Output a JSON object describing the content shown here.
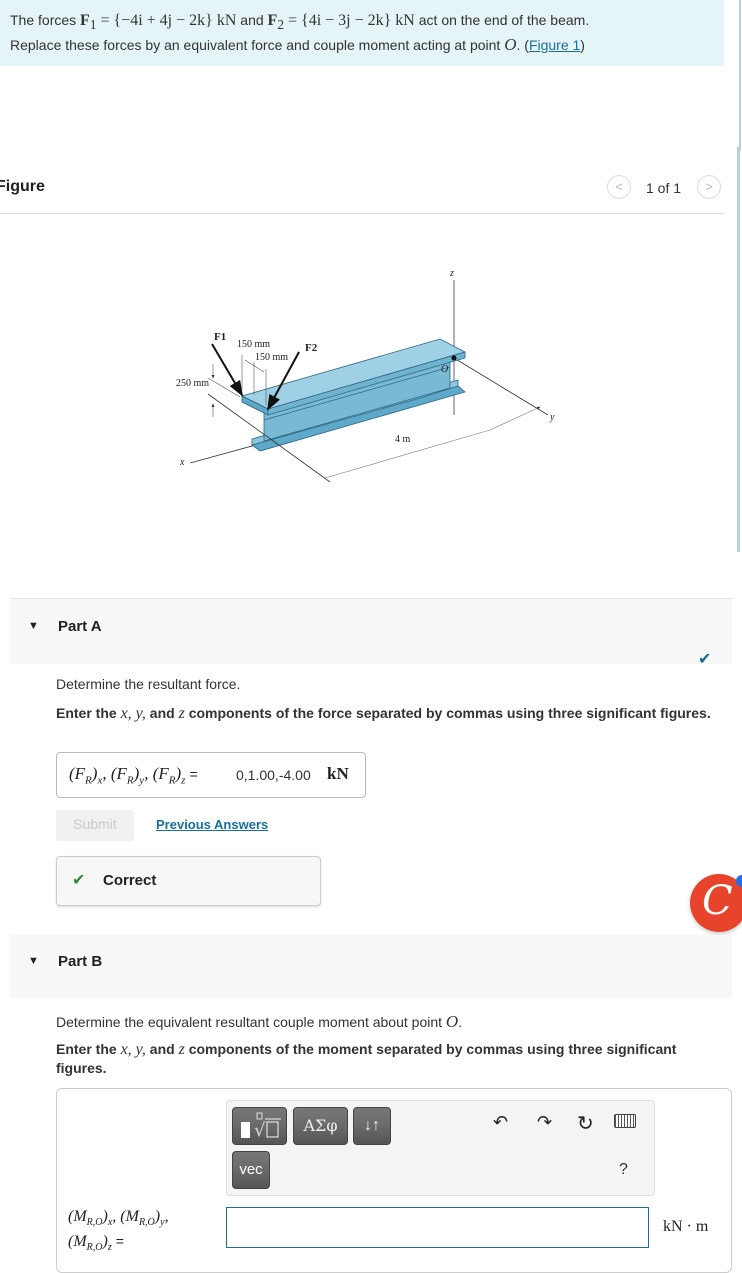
{
  "problem": {
    "intro": "The forces",
    "f1_label": "F",
    "f1_sub": "1",
    "f1_value": "= {−4i + 4j − 2k} kN",
    "and": "and",
    "f2_label": "F",
    "f2_sub": "2",
    "f2_value": "= {4i − 3j − 2k} kN",
    "suffix": "act on the end of the beam.",
    "line2": "Replace these forces by an equivalent force and couple moment acting at point",
    "point": "O",
    "link_open": ". (",
    "link_text": "Figure 1",
    "link_close": ")"
  },
  "figure": {
    "title": "Figure",
    "pager": "1 of 1",
    "prev_icon": "chevron-left-icon",
    "next_icon": "chevron-right-icon",
    "labels": {
      "f1": "F1",
      "f2": "F2",
      "dim_150_a": "150 mm",
      "dim_150_b": "150 mm",
      "dim_250": "250 mm",
      "dim_4m": "4 m",
      "axis_x": "x",
      "axis_y": "y",
      "axis_z": "z",
      "origin": "O"
    }
  },
  "partA": {
    "title": "Part A",
    "toggle_icon": "▼",
    "status_icon": "✔",
    "prompt": "Determine the resultant force.",
    "instruction_pre": "Enter the",
    "instruction_vars": "x, y,",
    "instruction_and": "and",
    "instruction_z": "z",
    "instruction_post": "components of the force separated by commas using three significant figures.",
    "answer_label": "(F_R)_x, (F_R)_y, (F_R)_z =",
    "answer_value": "0,1.00,-4.00",
    "answer_unit": "kN",
    "submit_label": "Submit",
    "previous_answers_label": "Previous Answers",
    "feedback_icon": "✔",
    "feedback_text": "Correct"
  },
  "partB": {
    "title": "Part B",
    "toggle_icon": "▼",
    "prompt_pre": "Determine the equivalent resultant couple moment about point",
    "prompt_point": "O",
    "prompt_post": ".",
    "instruction_pre": "Enter the",
    "instruction_vars": "x, y,",
    "instruction_and": "and",
    "instruction_z": "z",
    "instruction_post": "components of the moment separated by commas using three significant figures.",
    "toolbar": {
      "templates_label": "▮√▯",
      "greek_label": "ΑΣφ",
      "sort_label": "↓↑",
      "vec_label": "vec",
      "undo_icon": "↶",
      "redo_icon": "↷",
      "reset_icon": "↻",
      "help_label": "?"
    },
    "answer_label_line1": "(M_R,O)_x, (M_R,O)_y,",
    "answer_label_line2": "(M_R,O)_z =",
    "answer_value": "",
    "answer_unit": "kN · m"
  },
  "extension": {
    "badge_glyph": "C"
  }
}
